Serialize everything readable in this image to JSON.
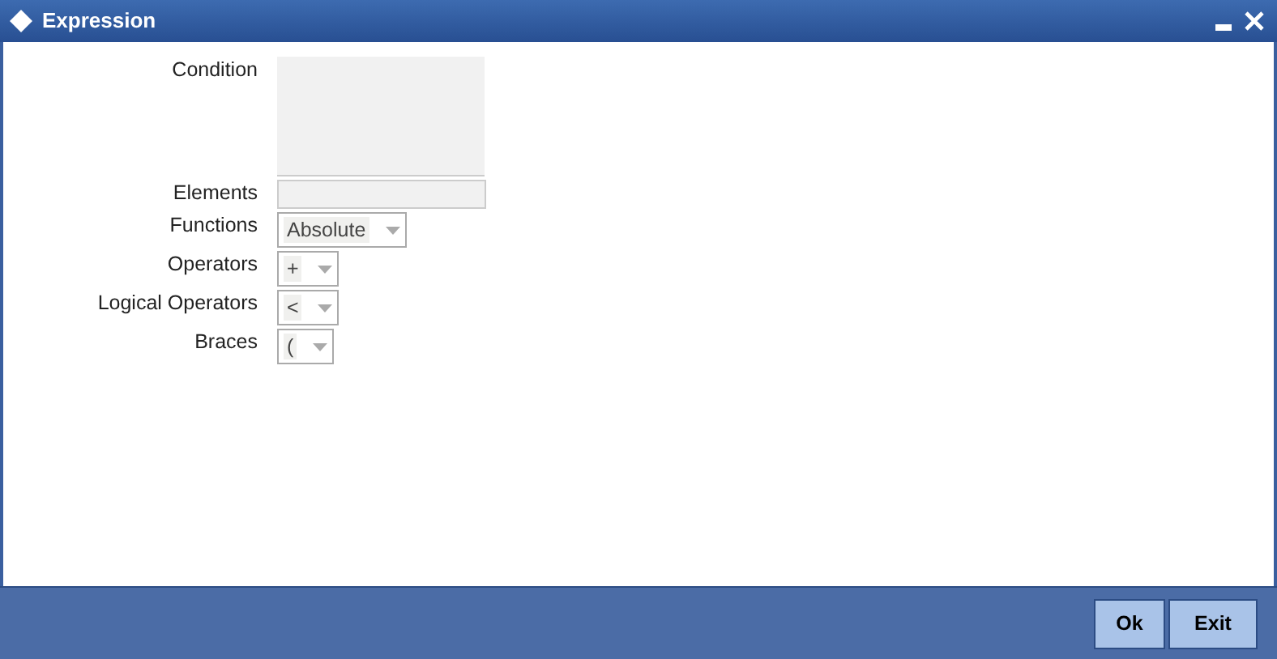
{
  "window": {
    "title": "Expression"
  },
  "fields": [
    {
      "label": "Condition",
      "kind": "textarea"
    },
    {
      "label": "Elements",
      "kind": "text"
    },
    {
      "label": "Functions",
      "kind": "select",
      "value": "Absolute"
    },
    {
      "label": "Operators",
      "kind": "select",
      "value": "+"
    },
    {
      "label": "Logical Operators",
      "kind": "select",
      "value": "<"
    },
    {
      "label": "Braces",
      "kind": "select",
      "value": "("
    }
  ],
  "buttons": [
    "Ok",
    "Exit"
  ]
}
